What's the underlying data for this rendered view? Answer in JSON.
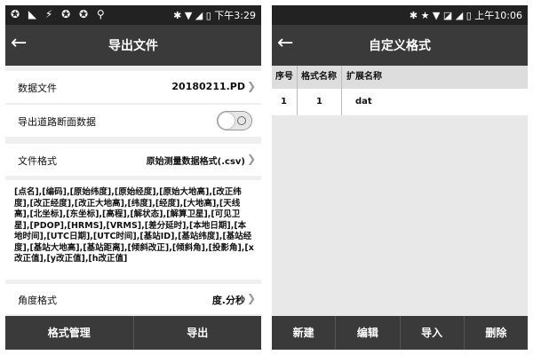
{
  "left": {
    "status": {
      "icons_left": "✪ ◣ ⚡ ✪ ✪ ⚲",
      "icons_right": "✱ ▼ ◢ ▯",
      "time": "下午3:29"
    },
    "header": {
      "title": "导出文件"
    },
    "data_file": {
      "label": "数据文件",
      "value": "20180211.PD"
    },
    "export_road": {
      "label": "导出道路断面数据"
    },
    "file_format": {
      "label": "文件格式",
      "value": "原始测量数据格式(.csv)"
    },
    "fields_text": "[点名],[编码],[原始纬度],[原始经度],[原始大地高],[改正纬度],[改正经度],[改正大地高],[纬度],[经度],[大地高],[天线高],[北坐标],[东坐标],[高程],[解状态],[解算卫星],[可见卫星],[PDOP],[HRMS],[VRMS],[差分延时],[本地日期],[本地时间],[UTC日期],[UTC时间],[基站ID],[基站纬度],[基站经度],[基站大地高],[基站距离],[倾斜改正],[倾斜角],[投影角],[x改正值],[y改正值],[h改正值]",
    "angle_format": {
      "label": "角度格式",
      "value": "度.分秒"
    },
    "buttons": {
      "manage": "格式管理",
      "export": "导出"
    }
  },
  "right": {
    "status": {
      "icons_left": "",
      "icons_right": "✱ ★ ▼ ◪ ◢ ▯",
      "time": "上午10:06"
    },
    "header": {
      "title": "自定义格式"
    },
    "table": {
      "headers": [
        "序号",
        "格式名称",
        "扩展名称"
      ],
      "rows": [
        [
          "1",
          "1",
          "dat"
        ]
      ]
    },
    "buttons": {
      "new": "新建",
      "edit": "编辑",
      "import": "导入",
      "delete": "删除"
    }
  }
}
